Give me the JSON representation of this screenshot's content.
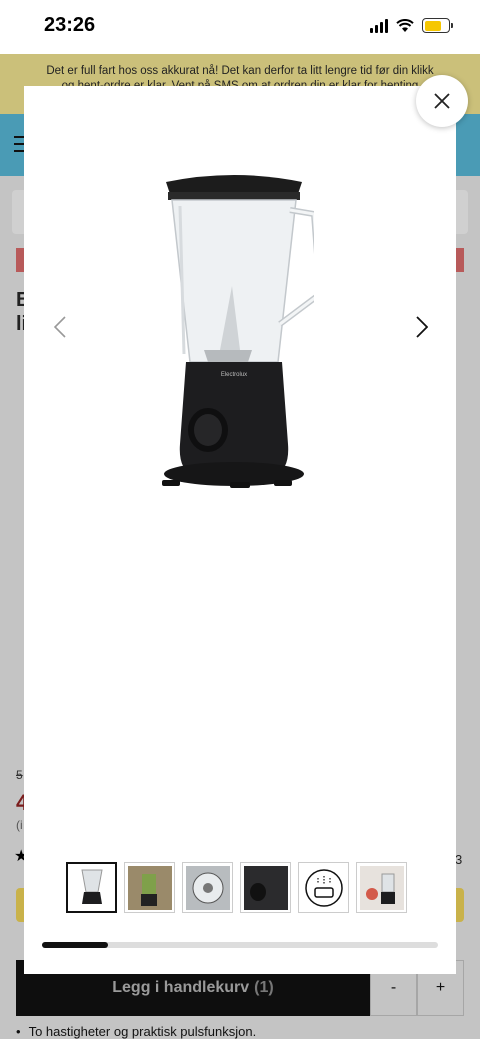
{
  "status_bar": {
    "time": "23:26",
    "battery_level": 0.7,
    "battery_color": "#f6c700"
  },
  "banner": {
    "text": "Det er full fart hos oss akkurat nå! Det kan derfor ta litt lengre tid før din klikk og hent-ordre er klar. Vent på SMS om at ordren din er klar for henting"
  },
  "background": {
    "title_partial": "B\nli",
    "price_old_partial": "5",
    "price_partial": "4",
    "info_partial": "(i",
    "rating_partial": "3"
  },
  "modal": {
    "thumbnails": [
      {
        "name": "thumbnail-blender-front"
      },
      {
        "name": "thumbnail-blender-kitchen"
      },
      {
        "name": "thumbnail-blender-top"
      },
      {
        "name": "thumbnail-blender-detail"
      },
      {
        "name": "thumbnail-dishwasher-safe"
      },
      {
        "name": "thumbnail-blender-fruit"
      }
    ],
    "gallery_progress": 0.167
  },
  "cart": {
    "button_label": "Legg i handlekurv",
    "count": "(1)",
    "minus_label": "-",
    "plus_label": "+"
  },
  "features": {
    "first": "To hastigheter og praktisk pulsfunksjon."
  },
  "colors": {
    "modal_bg": "#ffffff",
    "overlay": "#c4c4c4",
    "cart_button": "#0e0e0e",
    "header": "#4a9bb5"
  }
}
